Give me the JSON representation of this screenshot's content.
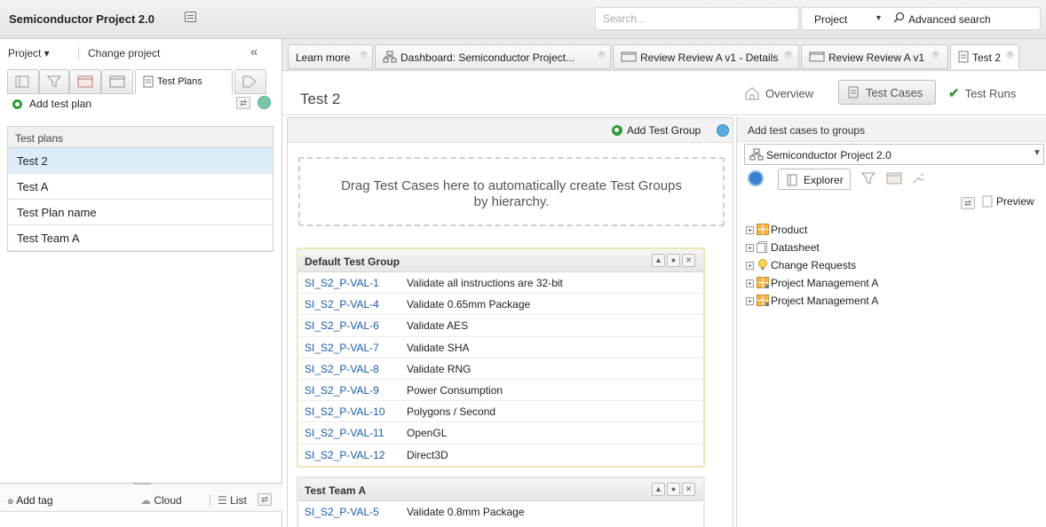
{
  "app": {
    "title": "Semiconductor Project 2.0"
  },
  "header": {
    "search_placeholder": "Search...",
    "scope": "Project",
    "advanced_search": "Advanced search"
  },
  "left": {
    "project_menu": "Project ▾",
    "change_project": "Change project",
    "collapse_glyph": "«",
    "active_tab": "Test Plans",
    "add_test_plan": "Add test plan",
    "plans_header": "Test plans",
    "plans": [
      "Test 2",
      "Test A",
      "Test Plan name",
      "Test Team A"
    ],
    "selected_plan": "Test 2",
    "add_tag": "Add tag",
    "cloud": "Cloud",
    "list": "List"
  },
  "tabs": [
    {
      "label": "Learn more"
    },
    {
      "label": "Dashboard: Semiconductor Project..."
    },
    {
      "label": "Review Review A v1 - Details"
    },
    {
      "label": "Review Review A v1"
    },
    {
      "label": "Test 2"
    }
  ],
  "main": {
    "title": "Test 2",
    "overview": "Overview",
    "test_cases": "Test Cases",
    "test_runs": "Test Runs",
    "add_test_group": "Add Test Group",
    "dropzone_text": "Drag Test Cases here to automatically create Test Groups by hierarchy."
  },
  "groups": [
    {
      "title": "Default Test Group",
      "rows": [
        {
          "id": "SI_S2_P-VAL-1",
          "name": "Validate all instructions are 32-bit"
        },
        {
          "id": "SI_S2_P-VAL-4",
          "name": "Validate 0.65mm Package"
        },
        {
          "id": "SI_S2_P-VAL-6",
          "name": "Validate AES"
        },
        {
          "id": "SI_S2_P-VAL-7",
          "name": "Validate SHA"
        },
        {
          "id": "SI_S2_P-VAL-8",
          "name": "Validate RNG"
        },
        {
          "id": "SI_S2_P-VAL-9",
          "name": "Power Consumption"
        },
        {
          "id": "SI_S2_P-VAL-10",
          "name": "Polygons / Second"
        },
        {
          "id": "SI_S2_P-VAL-11",
          "name": "OpenGL"
        },
        {
          "id": "SI_S2_P-VAL-12",
          "name": "Direct3D"
        }
      ]
    },
    {
      "title": "Test Team A",
      "rows": [
        {
          "id": "SI_S2_P-VAL-5",
          "name": "Validate 0.8mm Package"
        }
      ]
    }
  ],
  "right": {
    "title": "Add test cases to groups",
    "project": "Semiconductor Project 2.0",
    "explorer": "Explorer",
    "preview": "Preview",
    "tree": [
      "Product",
      "Datasheet",
      "Change Requests",
      "Project Management A",
      "Project Management A"
    ]
  },
  "colors": {
    "link": "#1a5aa8",
    "selected_row": "#dcedf8",
    "group_border": "#efe6b4",
    "add_green": "#2e9a3c"
  }
}
